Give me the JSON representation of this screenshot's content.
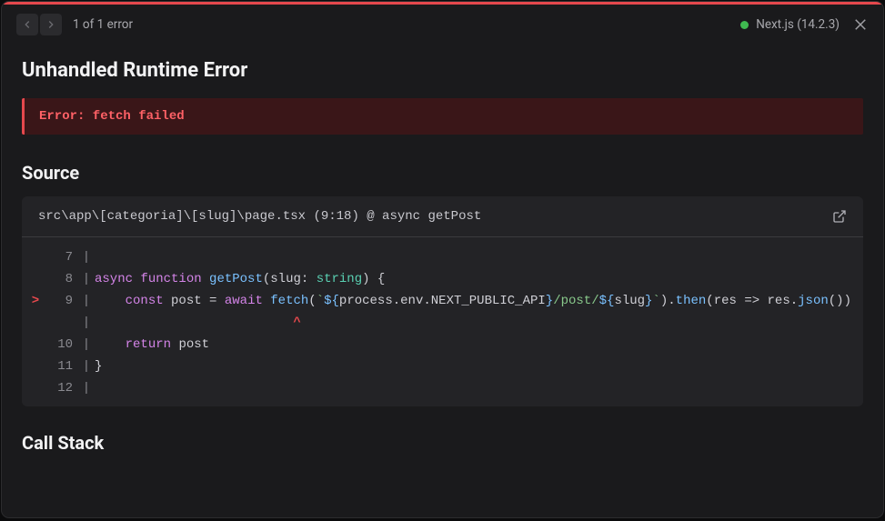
{
  "topbar": {
    "count_text": "1 of 1 error",
    "framework": "Next.js (14.2.3)"
  },
  "error": {
    "title": "Unhandled Runtime Error",
    "message": "Error: fetch failed"
  },
  "source": {
    "section_title": "Source",
    "location": "src\\app\\[categoria]\\[slug]\\page.tsx (9:18) @ async getPost",
    "caret_col_indent": "                          ^",
    "lines": [
      {
        "n": "7",
        "ptr": "",
        "html": ""
      },
      {
        "n": "8",
        "ptr": "",
        "html": "<span class=\"tok-kw\">async</span> <span class=\"tok-kw\">function</span> <span class=\"tok-fn\">getPost</span><span class=\"tok-punc\">(</span><span class=\"tok-var\">slug</span><span class=\"tok-punc\">:</span> <span class=\"tok-type\">string</span><span class=\"tok-punc\">)</span> <span class=\"tok-punc\">{</span>"
      },
      {
        "n": "9",
        "ptr": ">",
        "html": "    <span class=\"tok-kw\">const</span> <span class=\"tok-var\">post</span> <span class=\"tok-punc\">=</span> <span class=\"tok-kw\">await</span> <span class=\"tok-fn\">fetch</span><span class=\"tok-punc\">(</span><span class=\"tok-str\">`</span><span class=\"tok-tpl\">${</span><span class=\"tok-var\">process</span><span class=\"tok-punc\">.</span><span class=\"tok-var\">env</span><span class=\"tok-punc\">.</span><span class=\"tok-var\">NEXT_PUBLIC_API</span><span class=\"tok-tpl\">}</span><span class=\"tok-str\">/post/</span><span class=\"tok-tpl\">${</span><span class=\"tok-var\">slug</span><span class=\"tok-tpl\">}</span><span class=\"tok-str\">`</span><span class=\"tok-punc\">).</span><span class=\"tok-fn\">then</span><span class=\"tok-punc\">(</span><span class=\"tok-var\">res</span> <span class=\"tok-punc\">=&gt;</span> <span class=\"tok-var\">res</span><span class=\"tok-punc\">.</span><span class=\"tok-fn\">json</span><span class=\"tok-punc\">())</span>"
      },
      {
        "n": "",
        "ptr": "",
        "caret": true
      },
      {
        "n": "10",
        "ptr": "",
        "html": "    <span class=\"tok-kw\">return</span> <span class=\"tok-var\">post</span>"
      },
      {
        "n": "11",
        "ptr": "",
        "html": "<span class=\"tok-punc\">}</span>"
      },
      {
        "n": "12",
        "ptr": "",
        "html": ""
      }
    ]
  },
  "callstack": {
    "section_title": "Call Stack"
  }
}
